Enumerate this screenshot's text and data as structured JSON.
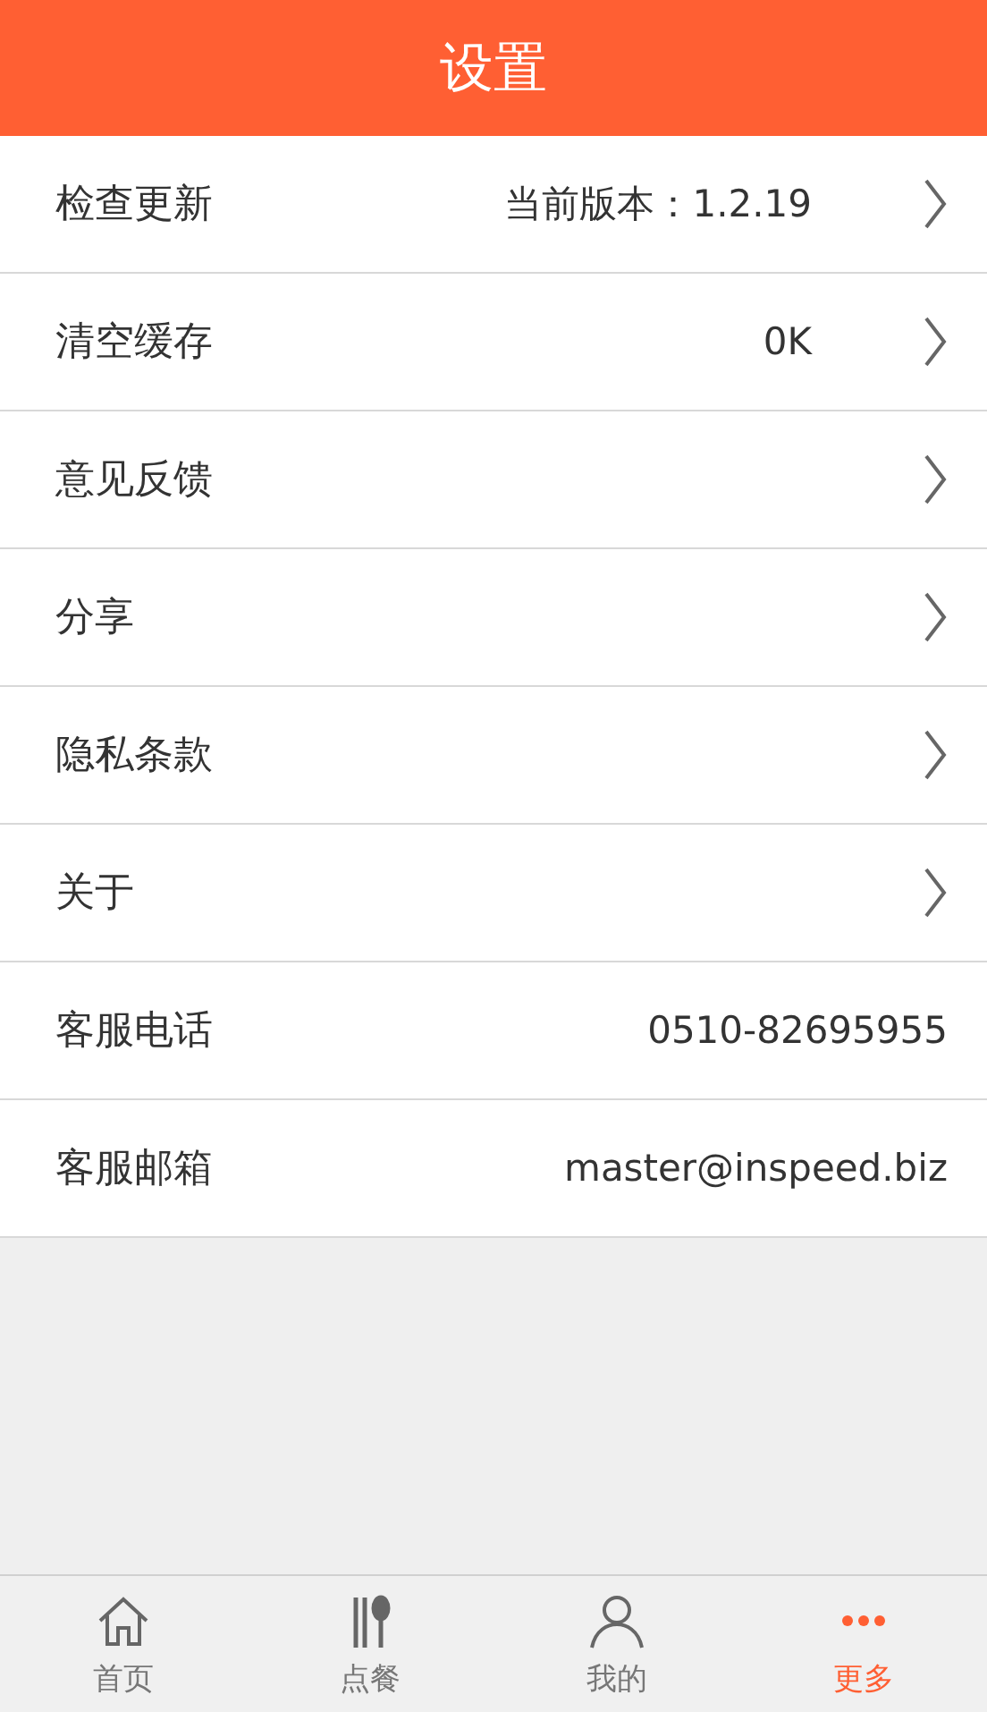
{
  "header": {
    "title": "设置"
  },
  "rows": [
    {
      "label": "检查更新",
      "value": "当前版本：1.2.19",
      "chevron": true
    },
    {
      "label": "清空缓存",
      "value": "0K",
      "chevron": true
    },
    {
      "label": "意见反馈",
      "chevron": true
    },
    {
      "label": "分享",
      "chevron": true
    },
    {
      "label": "隐私条款",
      "chevron": true
    },
    {
      "label": "关于",
      "chevron": true
    },
    {
      "label": "客服电话",
      "value": "0510-82695955",
      "chevron": false
    },
    {
      "label": "客服邮箱",
      "value": "master@inspeed.biz",
      "chevron": false
    }
  ],
  "tabs": [
    {
      "label": "首页",
      "kind": "home",
      "selected": false
    },
    {
      "label": "点餐",
      "kind": "dining",
      "selected": false
    },
    {
      "label": "我的",
      "kind": "user",
      "selected": false
    },
    {
      "label": "更多",
      "kind": "more",
      "selected": true
    }
  ]
}
